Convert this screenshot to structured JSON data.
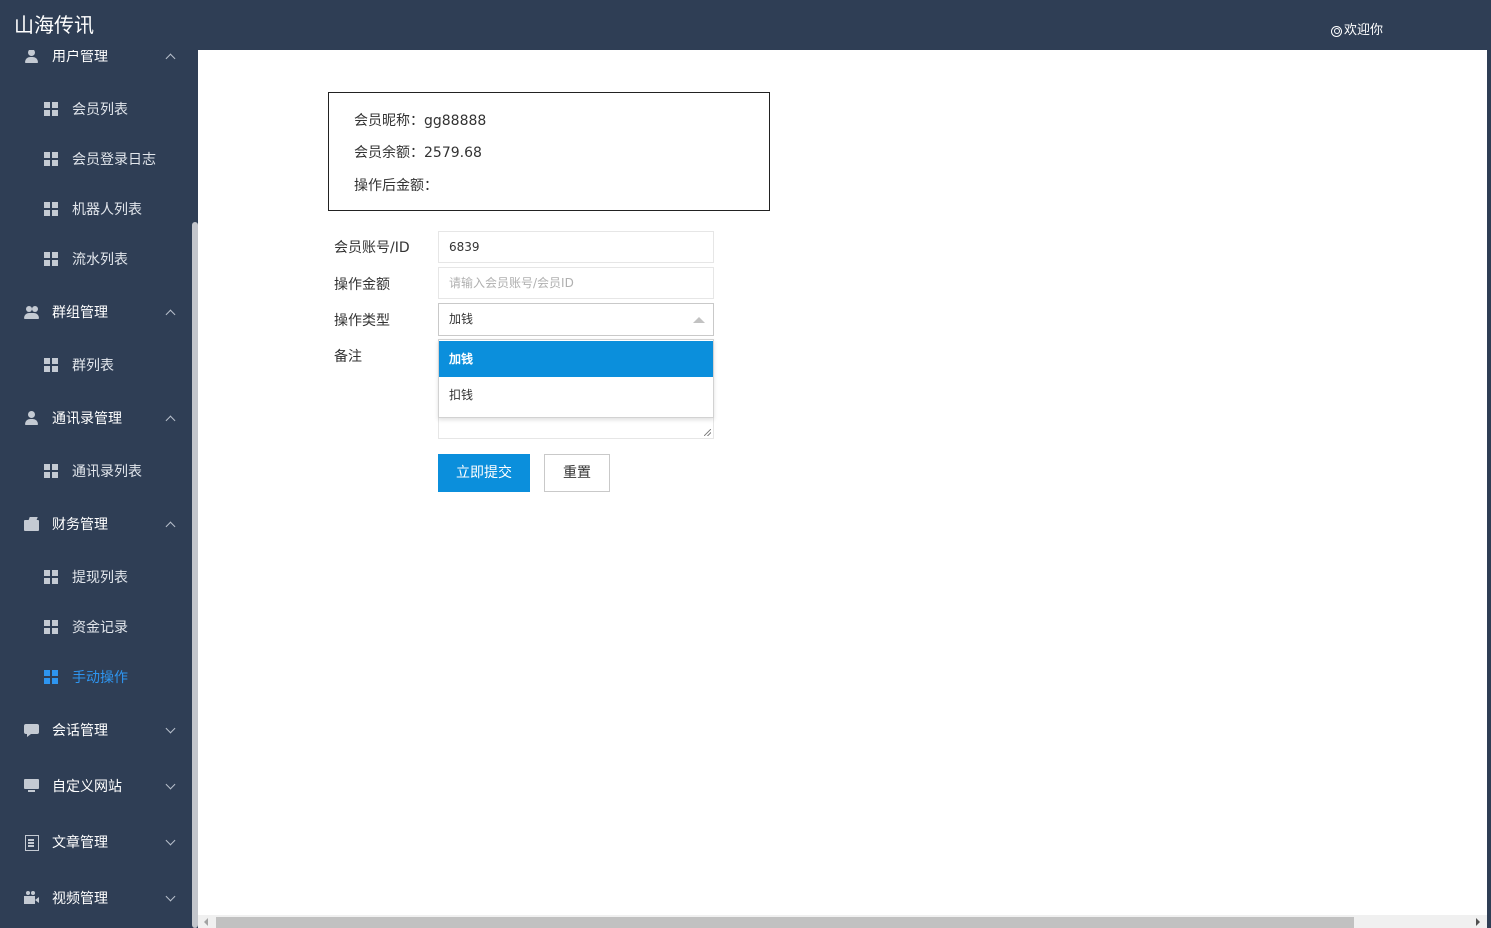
{
  "app": {
    "title": "山海传讯",
    "welcome": "欢迎你"
  },
  "sidebar": {
    "groups": [
      {
        "label": "用户管理",
        "icon": "user-icon",
        "expanded": true,
        "items": [
          {
            "label": "会员列表"
          },
          {
            "label": "会员登录日志"
          },
          {
            "label": "机器人列表"
          },
          {
            "label": "流水列表"
          }
        ]
      },
      {
        "label": "群组管理",
        "icon": "group-icon",
        "expanded": true,
        "items": [
          {
            "label": "群列表"
          }
        ]
      },
      {
        "label": "通讯录管理",
        "icon": "contact-icon",
        "expanded": true,
        "items": [
          {
            "label": "通讯录列表"
          }
        ]
      },
      {
        "label": "财务管理",
        "icon": "wallet-icon",
        "expanded": true,
        "items": [
          {
            "label": "提现列表"
          },
          {
            "label": "资金记录"
          },
          {
            "label": "手动操作",
            "active": true
          }
        ]
      },
      {
        "label": "会话管理",
        "icon": "chat-icon",
        "expanded": false,
        "items": []
      },
      {
        "label": "自定义网站",
        "icon": "monitor-icon",
        "expanded": false,
        "items": []
      },
      {
        "label": "文章管理",
        "icon": "document-icon",
        "expanded": false,
        "items": []
      },
      {
        "label": "视频管理",
        "icon": "video-icon",
        "expanded": false,
        "items": []
      }
    ]
  },
  "info": {
    "nickname_label": "会员昵称：",
    "nickname": "gg88888",
    "balance_label": "会员余额：",
    "balance": "2579.68",
    "after_label": "操作后金额：",
    "after": ""
  },
  "form": {
    "account_label": "会员账号/ID",
    "account_value": "6839",
    "amount_label": "操作金额",
    "amount_placeholder": "请输入会员账号/会员ID",
    "type_label": "操作类型",
    "type_value": "加钱",
    "type_options": [
      {
        "label": "加钱",
        "selected": true
      },
      {
        "label": "扣钱",
        "selected": false
      }
    ],
    "remark_label": "备注",
    "submit_label": "立即提交",
    "reset_label": "重置"
  },
  "colors": {
    "sidebar_bg": "#2f3e55",
    "primary": "#0b8fdc",
    "active_menu": "#2e95f0"
  }
}
